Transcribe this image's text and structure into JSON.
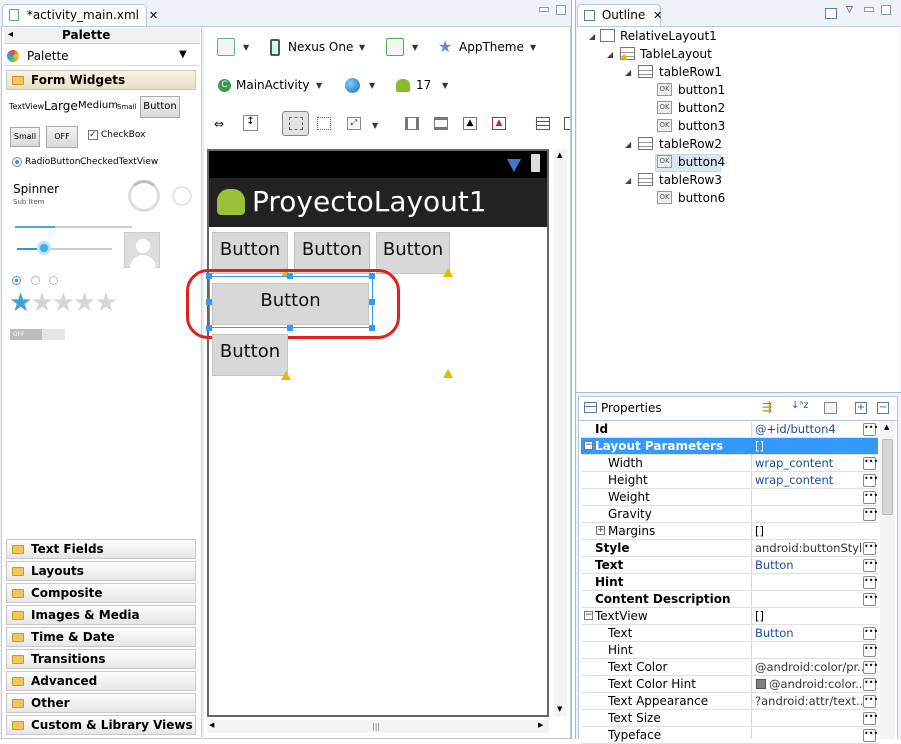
{
  "editor": {
    "tab_title": "*activity_main.xml",
    "palette_header": "Palette",
    "palette_title": "Palette",
    "categories_top": "Form Widgets",
    "widgets": {
      "textview": "TextView",
      "large": "Large",
      "medium": "Medium",
      "small": "Small",
      "button": "Button",
      "small_btn": "Small",
      "off_btn": "OFF",
      "checkbox": "CheckBox",
      "radiobutton": "RadioButton",
      "checkedtextview": "CheckedTextView",
      "spinner": "Spinner",
      "spinner_sub": "Sub Item",
      "switch_off": "OFF"
    },
    "categories": [
      "Text Fields",
      "Layouts",
      "Composite",
      "Images & Media",
      "Time & Date",
      "Transitions",
      "Advanced",
      "Other",
      "Custom & Library Views"
    ],
    "toolbar": {
      "device": "Nexus One",
      "theme": "AppTheme",
      "activity": "MainActivity",
      "api": "17"
    },
    "device_screen": {
      "app_title": "ProyectoLayout1",
      "row1": [
        "Button",
        "Button",
        "Button"
      ],
      "row2": "Button",
      "row3": "Button"
    }
  },
  "outline": {
    "title": "Outline",
    "tree": [
      "RelativeLayout1",
      "TableLayout",
      "tableRow1",
      "button1",
      "button2",
      "button3",
      "tableRow2",
      "button4",
      "tableRow3",
      "button6"
    ]
  },
  "properties": {
    "title": "Properties",
    "rows": [
      {
        "name": "Id",
        "value": "@+id/button4",
        "bold": true
      },
      {
        "name": "Layout Parameters",
        "value": "[]",
        "bold": true,
        "selected": true
      },
      {
        "name": "Width",
        "value": "wrap_content"
      },
      {
        "name": "Height",
        "value": "wrap_content"
      },
      {
        "name": "Weight",
        "value": ""
      },
      {
        "name": "Gravity",
        "value": ""
      },
      {
        "name": "Margins",
        "value": "[]"
      },
      {
        "name": "Style",
        "value": "android:buttonStyle",
        "bold": true
      },
      {
        "name": "Text",
        "value": "Button",
        "bold": true
      },
      {
        "name": "Hint",
        "value": "",
        "bold": true
      },
      {
        "name": "Content Description",
        "value": "",
        "bold": true
      },
      {
        "name": "TextView",
        "value": "[]"
      },
      {
        "name": "Text",
        "value": "Button"
      },
      {
        "name": "Hint",
        "value": ""
      },
      {
        "name": "Text Color",
        "value": "@android:color/pr..."
      },
      {
        "name": "Text Color Hint",
        "value": "@android:color..."
      },
      {
        "name": "Text Appearance",
        "value": "?android:attr/text..."
      },
      {
        "name": "Text Size",
        "value": ""
      },
      {
        "name": "Typeface",
        "value": ""
      }
    ]
  },
  "colors": {
    "selection": "#3399ff",
    "highlight_ring": "#e02020",
    "action_bar": "#222222",
    "link": "#1a4d9a"
  }
}
